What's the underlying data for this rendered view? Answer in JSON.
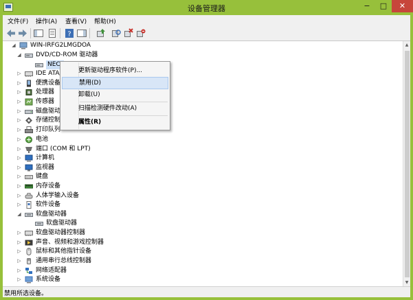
{
  "window": {
    "title": "设备管理器",
    "controls": {
      "minimize": "−",
      "maximize": "□",
      "close": "✕"
    }
  },
  "menu": [
    "文件(F)",
    "操作(A)",
    "查看(V)",
    "帮助(H)"
  ],
  "toolbar_icons": [
    "back-arrow-icon",
    "forward-arrow-icon",
    "show-hide-console-tree-icon",
    "properties-icon",
    "help-icon",
    "show-action-pane-icon",
    "update-driver-icon",
    "scan-hardware-icon",
    "disable-device-icon",
    "uninstall-device-icon"
  ],
  "tree": {
    "root": "WIN-IRFG2LMGDOA",
    "items": [
      {
        "label": "DVD/CD-ROM 驱动器",
        "toggle": "◢",
        "icon": "dvd-drive-icon"
      },
      {
        "label": "NECVMWar VMware SATA CD01",
        "toggle": "",
        "icon": "dvd-drive-icon"
      },
      {
        "label": "IDE ATA/ATAPI 控制器",
        "toggle": "▷",
        "icon": "ide-controller-icon"
      },
      {
        "label": "便携设备",
        "toggle": "▷",
        "icon": "portable-device-icon"
      },
      {
        "label": "处理器",
        "toggle": "▷",
        "icon": "processor-icon"
      },
      {
        "label": "传感器",
        "toggle": "▷",
        "icon": "sensor-icon"
      },
      {
        "label": "磁盘驱动器",
        "toggle": "▷",
        "icon": "disk-drive-icon"
      },
      {
        "label": "存储控制器",
        "toggle": "▷",
        "icon": "storage-controller-icon"
      },
      {
        "label": "打印队列",
        "toggle": "▷",
        "icon": "print-queue-icon"
      },
      {
        "label": "电池",
        "toggle": "▷",
        "icon": "battery-icon"
      },
      {
        "label": "端口 (COM 和 LPT)",
        "toggle": "▷",
        "icon": "port-icon"
      },
      {
        "label": "计算机",
        "toggle": "▷",
        "icon": "computer-icon"
      },
      {
        "label": "监视器",
        "toggle": "▷",
        "icon": "monitor-icon"
      },
      {
        "label": "键盘",
        "toggle": "▷",
        "icon": "keyboard-icon"
      },
      {
        "label": "内存设备",
        "toggle": "▷",
        "icon": "memory-device-icon"
      },
      {
        "label": "人体学输入设备",
        "toggle": "▷",
        "icon": "hid-icon"
      },
      {
        "label": "软件设备",
        "toggle": "▷",
        "icon": "software-device-icon"
      },
      {
        "label": "软盘驱动器",
        "toggle": "◢",
        "icon": "floppy-drive-icon"
      },
      {
        "label": "软盘驱动器",
        "toggle": "",
        "icon": "floppy-drive-icon"
      },
      {
        "label": "软盘驱动器控制器",
        "toggle": "▷",
        "icon": "floppy-controller-icon"
      },
      {
        "label": "声音、视频和游戏控制器",
        "toggle": "▷",
        "icon": "sound-video-icon"
      },
      {
        "label": "鼠标和其他指针设备",
        "toggle": "▷",
        "icon": "mouse-icon"
      },
      {
        "label": "通用串行总线控制器",
        "toggle": "▷",
        "icon": "usb-controller-icon"
      },
      {
        "label": "网络适配器",
        "toggle": "▷",
        "icon": "network-adapter-icon"
      },
      {
        "label": "系统设备",
        "toggle": "▷",
        "icon": "system-device-icon"
      }
    ]
  },
  "context_menu": {
    "items": [
      {
        "label": "更新驱动程序软件(P)...",
        "hover": false
      },
      {
        "label": "禁用(D)",
        "hover": true
      },
      {
        "label": "卸载(U)",
        "hover": false
      },
      {
        "label": "扫描检测硬件改动(A)",
        "hover": false
      },
      {
        "label": "属性(R)",
        "hover": false
      }
    ]
  },
  "status": "禁用所选设备。",
  "colors": {
    "title_bar": "#97c03b",
    "close_button": "#c7463b",
    "menu_hover": "#d8e6f7"
  }
}
